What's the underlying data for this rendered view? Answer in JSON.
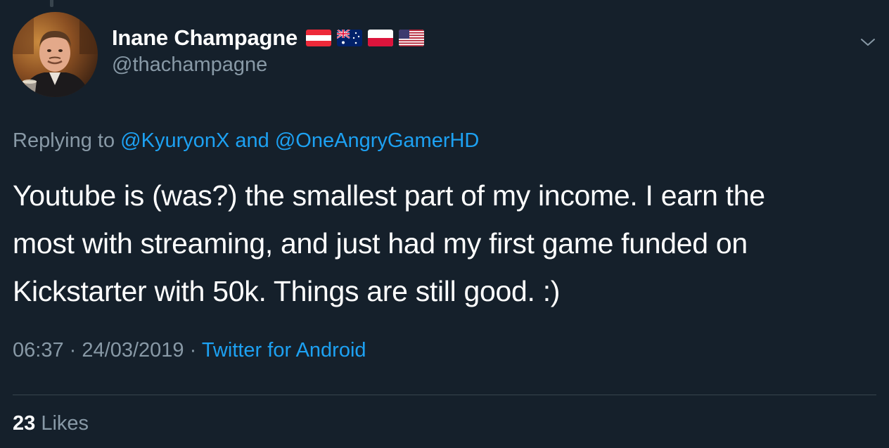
{
  "tweet": {
    "author": {
      "display_name": "Inane Champagne",
      "handle": "@thachampagne",
      "flags": [
        "austria-flag-icon",
        "australia-flag-icon",
        "poland-flag-icon",
        "usa-flag-icon"
      ]
    },
    "reply": {
      "prefix": "Replying to",
      "mentions": [
        "@KyuryonX",
        "@OneAngryGamerHD"
      ],
      "joiner": "and"
    },
    "text_lines": [
      "Youtube is (was?) the smallest part of my income. I earn the",
      "most with streaming, and just had my first game funded on",
      "Kickstarter with 50k. Things are still good. :)"
    ],
    "time": "06:37",
    "date": "24/03/2019",
    "separator": "·",
    "source": "Twitter for Android",
    "likes_count": "23",
    "likes_label": "Likes"
  },
  "icons": {
    "more": "chevron-down-icon"
  },
  "colors": {
    "background": "#15202b",
    "text": "#ffffff",
    "secondary": "#8899a6",
    "accent": "#1da1f2",
    "divider": "#38444d"
  }
}
